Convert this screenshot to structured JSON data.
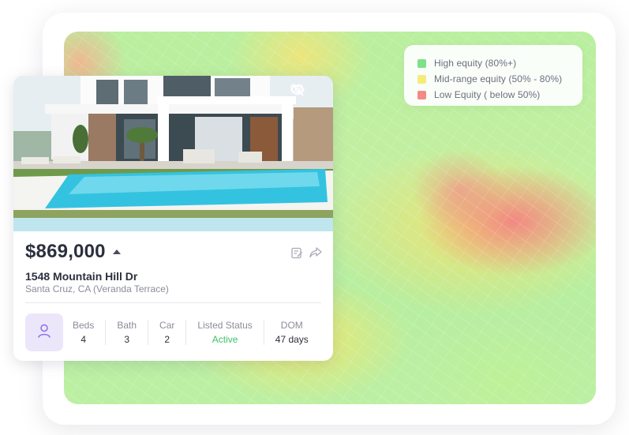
{
  "legend": {
    "items": [
      {
        "label": "High equity (80%+)",
        "color": "#7fe08a"
      },
      {
        "label": "Mid-range equity (50% - 80%)",
        "color": "#f3ec7a"
      },
      {
        "label": "Low Equity ( below 50%)",
        "color": "#f38a86"
      }
    ]
  },
  "listing": {
    "price": "$869,000",
    "trend_icon": "triangle-up-icon",
    "address": "1548 Mountain Hill Dr",
    "locality": "Santa Cruz, CA (Veranda Terrace)",
    "photo_icons": [
      "heart-icon",
      "eye-off-icon"
    ],
    "action_icons": [
      "edit-note-icon",
      "share-icon"
    ],
    "avatar_icon": "user-icon",
    "stats": {
      "beds_label": "Beds",
      "beds_value": "4",
      "bath_label": "Bath",
      "bath_value": "3",
      "car_label": "Car",
      "car_value": "2",
      "status_label": "Listed Status",
      "status_value": "Active",
      "dom_label": "DOM",
      "dom_value": "47 days"
    }
  }
}
